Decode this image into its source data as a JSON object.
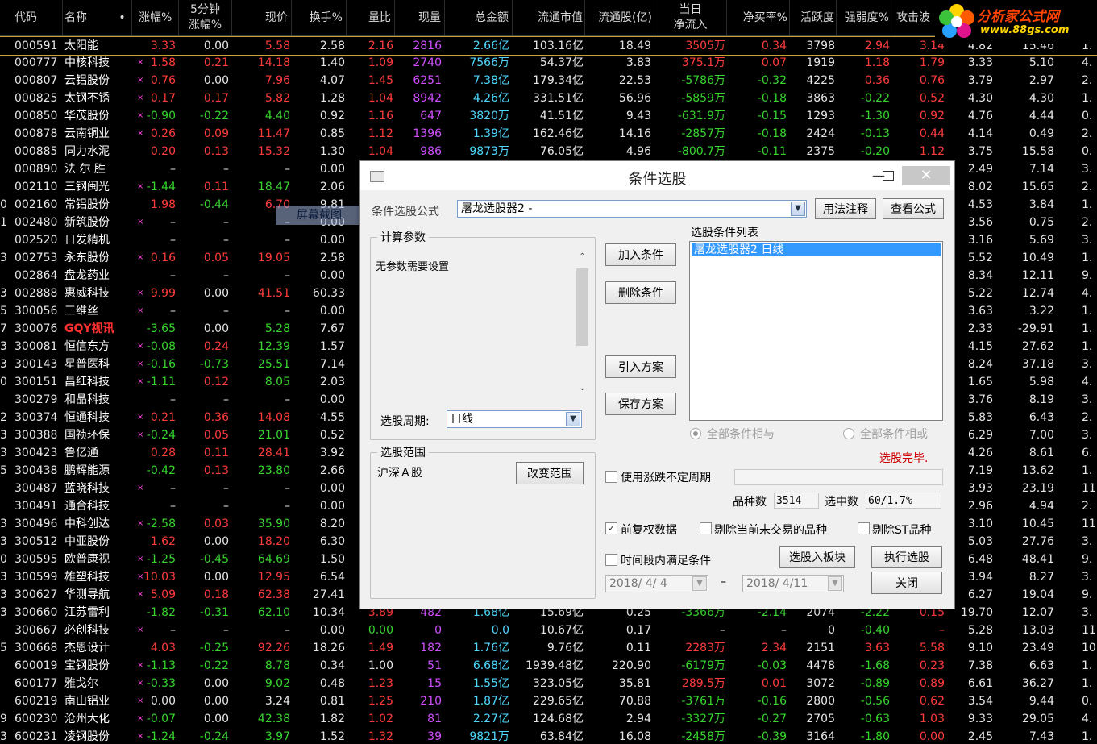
{
  "logo": {
    "line1": "分析家公式网",
    "line2": "www.88gs.com"
  },
  "columns": [
    {
      "l1": "代码",
      "l2": ""
    },
    {
      "l1": "名称",
      "l2": ""
    },
    {
      "l1": "•",
      "l2": ""
    },
    {
      "l1": "涨幅%",
      "l2": ""
    },
    {
      "l1": "5分钟",
      "l2": "涨幅%"
    },
    {
      "l1": "现价",
      "l2": ""
    },
    {
      "l1": "换手%",
      "l2": ""
    },
    {
      "l1": "量比",
      "l2": ""
    },
    {
      "l1": "现量",
      "l2": ""
    },
    {
      "l1": "总金额",
      "l2": ""
    },
    {
      "l1": "流通市值",
      "l2": ""
    },
    {
      "l1": "流通股(亿)",
      "l2": ""
    },
    {
      "l1": "当日",
      "l2": "净流入"
    },
    {
      "l1": "净买率%",
      "l2": ""
    },
    {
      "l1": "活跃度",
      "l2": ""
    },
    {
      "l1": "强弱度%",
      "l2": ""
    },
    {
      "l1": "攻击波",
      "l2": ""
    }
  ],
  "rows": [
    {
      "pre": "",
      "code": "000591",
      "name": "太阳能",
      "mark": "",
      "chg": "3.33",
      "chg5": "0.00",
      "price": "5.58",
      "turn": "2.58",
      "vr": "2.16",
      "vol": "2816",
      "amt": "2.66亿",
      "mv": "103.16亿",
      "fs": "18.49",
      "inflow": "3505万",
      "buy": "0.34",
      "act": "3798",
      "str": "2.94",
      "atk": "3.14",
      "e1": "4.82",
      "e2": "15.46",
      "e3": "1."
    },
    {
      "pre": "",
      "code": "000777",
      "name": "中核科技",
      "mark": "×",
      "chg": "1.58",
      "chg5": "0.21",
      "price": "14.18",
      "turn": "1.40",
      "vr": "1.09",
      "vol": "2740",
      "amt": "7566万",
      "mv": "54.37亿",
      "fs": "3.83",
      "inflow": "375.1万",
      "buy": "0.07",
      "act": "1919",
      "str": "1.18",
      "atk": "1.79",
      "e1": "3.33",
      "e2": "5.10",
      "e3": "4."
    },
    {
      "pre": "",
      "code": "000807",
      "name": "云铝股份",
      "mark": "×",
      "chg": "0.76",
      "chg5": "0.00",
      "price": "7.96",
      "turn": "4.07",
      "vr": "1.45",
      "vol": "6251",
      "amt": "7.38亿",
      "mv": "179.34亿",
      "fs": "22.53",
      "inflow": "-5786万",
      "buy": "-0.32",
      "act": "4225",
      "str": "0.36",
      "atk": "0.76",
      "e1": "3.79",
      "e2": "2.97",
      "e3": "2."
    },
    {
      "pre": "",
      "code": "000825",
      "name": "太钢不锈",
      "mark": "×",
      "chg": "0.17",
      "chg5": "0.17",
      "price": "5.82",
      "turn": "1.28",
      "vr": "1.04",
      "vol": "8942",
      "amt": "4.26亿",
      "mv": "331.51亿",
      "fs": "56.96",
      "inflow": "-5859万",
      "buy": "-0.18",
      "act": "3863",
      "str": "-0.22",
      "atk": "0.52",
      "e1": "4.30",
      "e2": "4.30",
      "e3": "1."
    },
    {
      "pre": "",
      "code": "000850",
      "name": "华茂股份",
      "mark": "×",
      "chg": "-0.90",
      "chg5": "-0.22",
      "price": "4.40",
      "turn": "0.92",
      "vr": "1.16",
      "vol": "647",
      "amt": "3820万",
      "mv": "41.51亿",
      "fs": "9.43",
      "inflow": "-631.9万",
      "buy": "-0.15",
      "act": "1293",
      "str": "-1.30",
      "atk": "0.92",
      "e1": "4.76",
      "e2": "4.44",
      "e3": "0."
    },
    {
      "pre": "",
      "code": "000878",
      "name": "云南铜业",
      "mark": "×",
      "chg": "0.26",
      "chg5": "0.09",
      "price": "11.47",
      "turn": "0.85",
      "vr": "1.12",
      "vol": "1396",
      "amt": "1.39亿",
      "mv": "162.46亿",
      "fs": "14.16",
      "inflow": "-2857万",
      "buy": "-0.18",
      "act": "2424",
      "str": "-0.13",
      "atk": "0.44",
      "e1": "4.14",
      "e2": "0.49",
      "e3": "2."
    },
    {
      "pre": "",
      "code": "000885",
      "name": "同力水泥",
      "mark": "",
      "chg": "0.20",
      "chg5": "0.13",
      "price": "15.32",
      "turn": "1.30",
      "vr": "1.04",
      "vol": "986",
      "amt": "9873万",
      "mv": "76.05亿",
      "fs": "4.96",
      "inflow": "-800.7万",
      "buy": "-0.11",
      "act": "2375",
      "str": "-0.20",
      "atk": "1.12",
      "e1": "3.75",
      "e2": "15.58",
      "e3": "0."
    },
    {
      "pre": "",
      "code": "000890",
      "name": "法 尔 胜",
      "mark": "",
      "chg": "–",
      "chg5": "–",
      "price": "–",
      "turn": "0.00",
      "vr": "",
      "vol": "",
      "amt": "",
      "mv": "",
      "fs": "",
      "inflow": "",
      "buy": "",
      "act": "",
      "str": "",
      "atk": "",
      "e1": "2.49",
      "e2": "7.14",
      "e3": "3."
    },
    {
      "pre": "",
      "code": "002110",
      "name": "三钢闽光",
      "mark": "×",
      "chg": "-1.44",
      "chg5": "0.11",
      "price": "18.47",
      "turn": "2.06",
      "vr": "",
      "vol": "",
      "amt": "",
      "mv": "",
      "fs": "",
      "inflow": "",
      "buy": "",
      "act": "",
      "str": "",
      "atk": "",
      "e1": "8.02",
      "e2": "15.65",
      "e3": "2."
    },
    {
      "pre": "0",
      "code": "002160",
      "name": "常铝股份",
      "mark": "",
      "chg": "1.98",
      "chg5": "-0.44",
      "price": "6.70",
      "turn": "9.81",
      "vr": "",
      "vol": "",
      "amt": "",
      "mv": "",
      "fs": "",
      "inflow": "",
      "buy": "",
      "act": "",
      "str": "",
      "atk": "",
      "e1": "4.53",
      "e2": "3.84",
      "e3": "1."
    },
    {
      "pre": "1",
      "code": "002480",
      "name": "新筑股份",
      "mark": "×",
      "chg": "–",
      "chg5": "–",
      "price": "–",
      "turn": "0.00",
      "vr": "",
      "vol": "",
      "amt": "",
      "mv": "",
      "fs": "",
      "inflow": "",
      "buy": "",
      "act": "",
      "str": "",
      "atk": "",
      "e1": "3.56",
      "e2": "0.75",
      "e3": "2."
    },
    {
      "pre": "",
      "code": "002520",
      "name": "日发精机",
      "mark": "",
      "chg": "–",
      "chg5": "–",
      "price": "–",
      "turn": "0.00",
      "vr": "",
      "vol": "",
      "amt": "",
      "mv": "",
      "fs": "",
      "inflow": "",
      "buy": "",
      "act": "",
      "str": "",
      "atk": "",
      "e1": "3.16",
      "e2": "5.69",
      "e3": "3."
    },
    {
      "pre": "3",
      "code": "002753",
      "name": "永东股份",
      "mark": "×",
      "chg": "0.16",
      "chg5": "0.05",
      "price": "19.05",
      "turn": "2.58",
      "vr": "",
      "vol": "",
      "amt": "",
      "mv": "",
      "fs": "",
      "inflow": "",
      "buy": "",
      "act": "",
      "str": "",
      "atk": "",
      "e1": "5.52",
      "e2": "10.49",
      "e3": "1."
    },
    {
      "pre": "",
      "code": "002864",
      "name": "盘龙药业",
      "mark": "",
      "chg": "–",
      "chg5": "–",
      "price": "–",
      "turn": "0.00",
      "vr": "",
      "vol": "",
      "amt": "",
      "mv": "",
      "fs": "",
      "inflow": "",
      "buy": "",
      "act": "",
      "str": "",
      "atk": "",
      "e1": "8.34",
      "e2": "12.11",
      "e3": "9."
    },
    {
      "pre": "3",
      "code": "002888",
      "name": "惠威科技",
      "mark": "×",
      "chg": "9.99",
      "chg5": "0.00",
      "price": "41.51",
      "turn": "60.33",
      "vr": "",
      "vol": "",
      "amt": "",
      "mv": "",
      "fs": "",
      "inflow": "",
      "buy": "",
      "act": "",
      "str": "",
      "atk": "",
      "e1": "5.22",
      "e2": "12.74",
      "e3": "4."
    },
    {
      "pre": "5",
      "code": "300056",
      "name": "三维丝",
      "mark": "×",
      "chg": "–",
      "chg5": "–",
      "price": "–",
      "turn": "0.00",
      "vr": "",
      "vol": "",
      "amt": "",
      "mv": "",
      "fs": "",
      "inflow": "",
      "buy": "",
      "act": "",
      "str": "",
      "atk": "",
      "e1": "3.63",
      "e2": "3.22",
      "e3": "1."
    },
    {
      "pre": "7",
      "code": "300076",
      "name": "GQY视讯",
      "mark": "",
      "chg": "-3.65",
      "chg5": "0.00",
      "price": "5.28",
      "turn": "7.67",
      "vr": "",
      "vol": "",
      "amt": "",
      "mv": "",
      "fs": "",
      "inflow": "",
      "buy": "",
      "act": "",
      "str": "",
      "atk": "",
      "e1": "2.33",
      "e2": "-29.91",
      "e3": "1."
    },
    {
      "pre": "3",
      "code": "300081",
      "name": "恒信东方",
      "mark": "×",
      "chg": "-0.08",
      "chg5": "0.24",
      "price": "12.39",
      "turn": "1.57",
      "vr": "",
      "vol": "",
      "amt": "",
      "mv": "",
      "fs": "",
      "inflow": "",
      "buy": "",
      "act": "",
      "str": "",
      "atk": "",
      "e1": "4.15",
      "e2": "27.62",
      "e3": "1."
    },
    {
      "pre": "3",
      "code": "300143",
      "name": "星普医科",
      "mark": "×",
      "chg": "-0.16",
      "chg5": "-0.73",
      "price": "25.51",
      "turn": "7.14",
      "vr": "",
      "vol": "",
      "amt": "",
      "mv": "",
      "fs": "",
      "inflow": "",
      "buy": "",
      "act": "",
      "str": "",
      "atk": "",
      "e1": "8.24",
      "e2": "37.18",
      "e3": "3."
    },
    {
      "pre": "0",
      "code": "300151",
      "name": "昌红科技",
      "mark": "×",
      "chg": "-1.11",
      "chg5": "0.12",
      "price": "8.05",
      "turn": "2.03",
      "vr": "",
      "vol": "",
      "amt": "",
      "mv": "",
      "fs": "",
      "inflow": "",
      "buy": "",
      "act": "",
      "str": "",
      "atk": "",
      "e1": "1.65",
      "e2": "5.98",
      "e3": "4."
    },
    {
      "pre": "",
      "code": "300279",
      "name": "和晶科技",
      "mark": "",
      "chg": "–",
      "chg5": "–",
      "price": "–",
      "turn": "0.00",
      "vr": "",
      "vol": "",
      "amt": "",
      "mv": "",
      "fs": "",
      "inflow": "",
      "buy": "",
      "act": "",
      "str": "",
      "atk": "",
      "e1": "3.76",
      "e2": "8.19",
      "e3": "3."
    },
    {
      "pre": "2",
      "code": "300374",
      "name": "恒通科技",
      "mark": "×",
      "chg": "0.21",
      "chg5": "0.36",
      "price": "14.08",
      "turn": "4.55",
      "vr": "",
      "vol": "",
      "amt": "",
      "mv": "",
      "fs": "",
      "inflow": "",
      "buy": "",
      "act": "",
      "str": "",
      "atk": "",
      "e1": "5.83",
      "e2": "6.43",
      "e3": "2."
    },
    {
      "pre": "3",
      "code": "300388",
      "name": "国祯环保",
      "mark": "×",
      "chg": "-0.24",
      "chg5": "0.05",
      "price": "21.01",
      "turn": "0.52",
      "vr": "",
      "vol": "",
      "amt": "",
      "mv": "",
      "fs": "",
      "inflow": "",
      "buy": "",
      "act": "",
      "str": "",
      "atk": "",
      "e1": "6.29",
      "e2": "7.00",
      "e3": "3."
    },
    {
      "pre": "3",
      "code": "300423",
      "name": "鲁亿通",
      "mark": "",
      "chg": "0.28",
      "chg5": "0.11",
      "price": "28.41",
      "turn": "3.92",
      "vr": "",
      "vol": "",
      "amt": "",
      "mv": "",
      "fs": "",
      "inflow": "",
      "buy": "",
      "act": "",
      "str": "",
      "atk": "",
      "e1": "4.26",
      "e2": "8.61",
      "e3": "6."
    },
    {
      "pre": "5",
      "code": "300438",
      "name": "鹏辉能源",
      "mark": "",
      "chg": "-0.42",
      "chg5": "0.13",
      "price": "23.80",
      "turn": "2.66",
      "vr": "",
      "vol": "",
      "amt": "",
      "mv": "",
      "fs": "",
      "inflow": "",
      "buy": "",
      "act": "",
      "str": "",
      "atk": "",
      "e1": "7.19",
      "e2": "13.62",
      "e3": "1."
    },
    {
      "pre": "",
      "code": "300487",
      "name": "蓝晓科技",
      "mark": "×",
      "chg": "–",
      "chg5": "–",
      "price": "–",
      "turn": "0.00",
      "vr": "",
      "vol": "",
      "amt": "",
      "mv": "",
      "fs": "",
      "inflow": "",
      "buy": "",
      "act": "",
      "str": "",
      "atk": "",
      "e1": "3.93",
      "e2": "23.19",
      "e3": "11."
    },
    {
      "pre": "",
      "code": "300491",
      "name": "通合科技",
      "mark": "",
      "chg": "–",
      "chg5": "–",
      "price": "–",
      "turn": "0.00",
      "vr": "",
      "vol": "",
      "amt": "",
      "mv": "",
      "fs": "",
      "inflow": "",
      "buy": "",
      "act": "",
      "str": "",
      "atk": "",
      "e1": "2.96",
      "e2": "4.94",
      "e3": "2."
    },
    {
      "pre": "3",
      "code": "300496",
      "name": "中科创达",
      "mark": "×",
      "chg": "-2.58",
      "chg5": "0.03",
      "price": "35.90",
      "turn": "8.20",
      "vr": "",
      "vol": "",
      "amt": "",
      "mv": "",
      "fs": "",
      "inflow": "",
      "buy": "",
      "act": "",
      "str": "",
      "atk": "",
      "e1": "3.10",
      "e2": "10.45",
      "e3": "11."
    },
    {
      "pre": "3",
      "code": "300512",
      "name": "中亚股份",
      "mark": "",
      "chg": "1.62",
      "chg5": "0.00",
      "price": "18.20",
      "turn": "6.30",
      "vr": "",
      "vol": "",
      "amt": "",
      "mv": "",
      "fs": "",
      "inflow": "",
      "buy": "",
      "act": "",
      "str": "",
      "atk": "",
      "e1": "5.03",
      "e2": "27.76",
      "e3": "3."
    },
    {
      "pre": "0",
      "code": "300595",
      "name": "欧普康视",
      "mark": "×",
      "chg": "-1.25",
      "chg5": "-0.45",
      "price": "64.69",
      "turn": "1.50",
      "vr": "",
      "vol": "",
      "amt": "",
      "mv": "",
      "fs": "",
      "inflow": "",
      "buy": "",
      "act": "",
      "str": "",
      "atk": "",
      "e1": "6.48",
      "e2": "48.41",
      "e3": "9."
    },
    {
      "pre": "3",
      "code": "300599",
      "name": "雄塑科技",
      "mark": "×",
      "chg": "10.03",
      "chg5": "0.00",
      "price": "12.95",
      "turn": "6.54",
      "vr": "",
      "vol": "",
      "amt": "",
      "mv": "",
      "fs": "",
      "inflow": "",
      "buy": "",
      "act": "",
      "str": "",
      "atk": "",
      "e1": "3.94",
      "e2": "8.27",
      "e3": "3."
    },
    {
      "pre": "3",
      "code": "300627",
      "name": "华测导航",
      "mark": "×",
      "chg": "5.09",
      "chg5": "0.18",
      "price": "62.38",
      "turn": "27.41",
      "vr": "",
      "vol": "",
      "amt": "",
      "mv": "",
      "fs": "",
      "inflow": "",
      "buy": "",
      "act": "",
      "str": "",
      "atk": "",
      "e1": "6.27",
      "e2": "19.04",
      "e3": "9."
    },
    {
      "pre": "3",
      "code": "300660",
      "name": "江苏雷利",
      "mark": "",
      "chg": "-1.82",
      "chg5": "-0.31",
      "price": "62.10",
      "turn": "10.34",
      "vr": "3.89",
      "vol": "482",
      "amt": "1.68亿",
      "mv": "15.69亿",
      "fs": "0.25",
      "inflow": "-3366万",
      "buy": "-2.14",
      "act": "2074",
      "str": "-2.22",
      "atk": "0.15",
      "e1": "19.70",
      "e2": "12.07",
      "e3": "3."
    },
    {
      "pre": "",
      "code": "300667",
      "name": "必创科技",
      "mark": "×",
      "chg": "–",
      "chg5": "–",
      "price": "–",
      "turn": "0.00",
      "vr": "0.00",
      "vol": "0",
      "amt": "0.0",
      "mv": "10.67亿",
      "fs": "0.17",
      "inflow": "–",
      "buy": "–",
      "act": "0",
      "str": "-0.40",
      "atk": "–",
      "e1": "5.28",
      "e2": "13.03",
      "e3": "11."
    },
    {
      "pre": "5",
      "code": "300668",
      "name": "杰恩设计",
      "mark": "",
      "chg": "4.03",
      "chg5": "-0.25",
      "price": "92.26",
      "turn": "18.26",
      "vr": "1.49",
      "vol": "182",
      "amt": "1.76亿",
      "mv": "9.76亿",
      "fs": "0.11",
      "inflow": "2283万",
      "buy": "2.34",
      "act": "2151",
      "str": "3.63",
      "atk": "5.58",
      "e1": "9.10",
      "e2": "23.49",
      "e3": "10."
    },
    {
      "pre": "",
      "code": "600019",
      "name": "宝钢股份",
      "mark": "×",
      "chg": "-1.13",
      "chg5": "-0.22",
      "price": "8.78",
      "turn": "0.34",
      "vr": "1.00",
      "vol": "51",
      "amt": "6.68亿",
      "mv": "1939.48亿",
      "fs": "220.90",
      "inflow": "-6179万",
      "buy": "-0.03",
      "act": "4478",
      "str": "-1.68",
      "atk": "0.23",
      "e1": "7.38",
      "e2": "6.63",
      "e3": "1."
    },
    {
      "pre": "",
      "code": "600177",
      "name": "雅戈尔",
      "mark": "×",
      "chg": "-0.33",
      "chg5": "0.00",
      "price": "9.02",
      "turn": "0.48",
      "vr": "1.23",
      "vol": "15",
      "amt": "1.55亿",
      "mv": "323.05亿",
      "fs": "35.81",
      "inflow": "289.5万",
      "buy": "0.01",
      "act": "3072",
      "str": "-0.89",
      "atk": "0.89",
      "e1": "6.61",
      "e2": "36.27",
      "e3": "1."
    },
    {
      "pre": "",
      "code": "600219",
      "name": "南山铝业",
      "mark": "×",
      "chg": "0.00",
      "chg5": "0.00",
      "price": "3.24",
      "turn": "0.81",
      "vr": "1.25",
      "vol": "210",
      "amt": "1.87亿",
      "mv": "229.65亿",
      "fs": "70.88",
      "inflow": "-3761万",
      "buy": "-0.16",
      "act": "2800",
      "str": "-0.56",
      "atk": "0.62",
      "e1": "3.54",
      "e2": "9.44",
      "e3": "0."
    },
    {
      "pre": "9",
      "code": "600230",
      "name": "沧州大化",
      "mark": "×",
      "chg": "-0.07",
      "chg5": "0.00",
      "price": "42.38",
      "turn": "1.82",
      "vr": "1.02",
      "vol": "81",
      "amt": "2.27亿",
      "mv": "124.68亿",
      "fs": "2.94",
      "inflow": "-3327万",
      "buy": "-0.27",
      "act": "2705",
      "str": "-0.63",
      "atk": "1.03",
      "e1": "9.33",
      "e2": "29.05",
      "e3": "4."
    },
    {
      "pre": "3",
      "code": "600231",
      "name": "凌钢股份",
      "mark": "×",
      "chg": "-1.24",
      "chg5": "-0.24",
      "price": "3.97",
      "turn": "1.52",
      "vr": "1.32",
      "vol": "39",
      "amt": "9821万",
      "mv": "63.84亿",
      "fs": "16.08",
      "inflow": "-2458万",
      "buy": "-0.39",
      "act": "3164",
      "str": "-1.80",
      "atk": "0.00",
      "e1": "2.45",
      "e2": "7.43",
      "e3": "1."
    }
  ],
  "overlay": {
    "label": "屏幕截图",
    "num": "35"
  },
  "dialog": {
    "title": "条件选股",
    "formula_label": "条件选股公式",
    "formula_value": "屠龙选股器2  -",
    "btn_usage": "用法注释",
    "btn_view": "查看公式",
    "params_group": "计算参数",
    "params_text": "无参数需要设置",
    "period_label": "选股周期:",
    "period_value": "日线",
    "btn_add": "加入条件",
    "btn_delete": "删除条件",
    "btn_import": "引入方案",
    "btn_save": "保存方案",
    "cond_list_label": "选股条件列表",
    "cond_items": [
      "屠龙选股器2   日线"
    ],
    "radio_and": "全部条件相与",
    "radio_or": "全部条件相或",
    "status": "选股完毕.",
    "range_group": "选股范围",
    "range_value": "沪深Ａ股",
    "btn_change_range": "改变范围",
    "chk_uncertain": "使用涨跌不定周期",
    "count_label": "品种数",
    "count_value": "3514",
    "selected_label": "选中数",
    "selected_value": "60/1.7%",
    "chk_adjust": "前复权数据",
    "chk_exclude_untraded": "剔除当前未交易的品种",
    "chk_exclude_st": "剔除ST品种",
    "chk_timerange": "时间段内满足条件",
    "btn_to_block": "选股入板块",
    "btn_execute": "执行选股",
    "date_from": "2018/ 4/ 4",
    "date_to": "2018/ 4/11",
    "dash": "–",
    "btn_close": "关闭",
    "check_mark": "✓"
  },
  "colors": {
    "up": "#ff3c3c",
    "down": "#37d52e",
    "amount": "#4fd8ff",
    "volume": "#d050ff",
    "selected_item": "#3399ff",
    "status": "#cc0000"
  }
}
